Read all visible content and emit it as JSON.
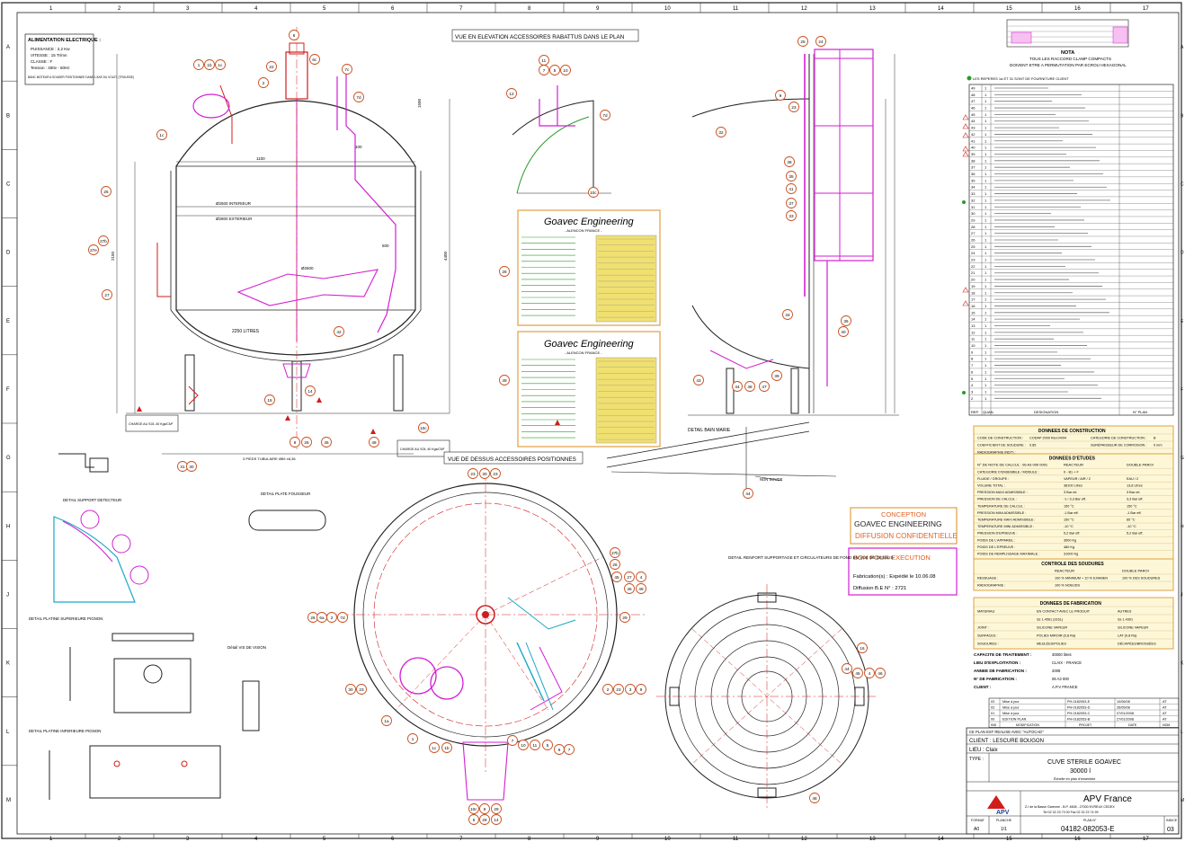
{
  "grid": {
    "columns": [
      "1",
      "2",
      "3",
      "4",
      "5",
      "6",
      "7",
      "8",
      "9",
      "10",
      "11",
      "12",
      "13",
      "14",
      "15",
      "16",
      "17"
    ],
    "rows": [
      "A",
      "B",
      "C",
      "D",
      "E",
      "F",
      "G",
      "H",
      "J",
      "K",
      "L",
      "M"
    ]
  },
  "views": {
    "elevation_title": "VUE EN ELEVATION ACCESSOIRES RABATTUS DANS LE PLAN",
    "top_title": "VUE DE DESSUS ACCESSOIRES POSITIONNES",
    "bain_marie": "DETAIL BAIN MARIE",
    "support_detail": "DETAIL SUPPORT DETECTEUR",
    "plate_detail": "DETAIL PLATE FOUSSEUR",
    "platine_sup": "DETAIL PLATINE SUPERIEURE PIGNON",
    "platine_inf": "DETAIL PLATINE INFERIEURE PIGNON",
    "vis_detail": "Détail VIS DE VISION",
    "support_fond": "DETAIL RENFORT SUPPORTAGE ET CIRCULATEURS DE FOND EN VUE DE DESSUS",
    "non_soude": "NON SOUDE"
  },
  "elevation": {
    "alim_title": "ALIMENTATION ELECTRIQUE :",
    "alim_lines": [
      "PUISSANCE : 2,2 Kw",
      "VITESSE : 15 Tr/mn",
      "CLASSE : F",
      "Tension : 400v - 50Hz"
    ],
    "alim_note": "BANC MOTEUR A SOUDER POSITIONNEE DANS L'AXE DU VOLET (TROUSSE)",
    "litres": "2250 LITRES",
    "charge_left": "CHARGE AU SOL 40 Kgs/CM²",
    "charge_right": "CHARGE AU SOL 40 Kgs/CM²",
    "pieds": "3 PIEDS TUBULAIRE Ø89 ±8,36",
    "dims": [
      "Ø2600",
      "Ø2500 INTERIEUR",
      "Ø2800 EXTERIEUR",
      "1100",
      "4400",
      "500",
      "1500",
      "2150",
      "100"
    ]
  },
  "goavec_plates": [
    {
      "name": "Goavec Engineering",
      "sub": "- ALENCON FRANCE -"
    },
    {
      "name": "Goavec Engineering",
      "sub": "- ALENCON FRANCE -"
    }
  ],
  "conception": {
    "l1": "CONCEPTION",
    "l2": "GOAVEC ENGINEERING",
    "l3": "DIFFUSION CONFIDENTIELLE"
  },
  "bon_pour": {
    "title": "BON POUR EXECUTION",
    "fab": "Fabrication(s) : Expédié le 10.06.08",
    "diff": "Diffusion B.E N° : 2721"
  },
  "nota": {
    "title": "NOTA",
    "lines": [
      "TOUS LES RACCORD CLAMP COMPACTS",
      "DOIVENT ETRE A PERMUTATION PAR ECROU HEXAGONAL"
    ]
  },
  "nomenclature_note": "LES REPERES 1a ET 31 SONT DE FOURNITURE CLIENT",
  "nomenclature_header": [
    "REP.",
    "QUAN.",
    "DESIGNATION",
    "N° PLAN"
  ],
  "construction": {
    "title": "DONNEES DE CONSTRUCTION",
    "rows": [
      [
        "CODE DE CONSTRUCTION :",
        "CODAP 2000 Rev.04/04",
        "CATEGORIE DE CONSTRUCTION :",
        "B"
      ],
      [
        "COEFFICIENT DE SOUDURE :",
        "0.85",
        "SURÉPAISSEUR DE CORROSION :",
        "0 mm"
      ],
      [
        "RADIOGRAPHIE (NDT) :",
        "",
        "",
        ""
      ]
    ]
  },
  "etudes": {
    "title": "DONNEES D'ETUDES",
    "note_calcul": "N° DE NOTE DE CALCUL : 06 A3 000 0001",
    "cols": [
      "",
      "REACTEUR",
      "DOUBLE PAROI"
    ],
    "rows": [
      [
        "CATEGORIE D'ENSEMBLE / MODULE :",
        "II - B1 + F",
        ""
      ],
      [
        "FLUIDE / GROUPE :",
        "VAPEUR / AIR / 2",
        "EAU / 2"
      ],
      [
        "VOLUME TOTAL :",
        "38100 Litres",
        "13,8 Litres"
      ],
      [
        "PRESSION MAXI ADMISSIBLE :",
        "3 Bar rel.",
        "3 Bar rel."
      ],
      [
        "PRESSION DE CALCUL :",
        "-1 / 3,3 Bar eff.",
        "3,3 Bar eff."
      ],
      [
        "TEMPERATURE DE CALCUL :",
        "150 °C",
        "150 °C"
      ],
      [
        "PRESSION MINI ADMISSIBLE :",
        "-1 Bar eff.",
        "-1 Bar eff."
      ],
      [
        "TEMPERATURE MAXI ADMISSIBLE :",
        "150 °C",
        "65 °C"
      ],
      [
        "TEMPERATURE MINI ADMISSIBLE :",
        "-10 °C",
        "-10 °C"
      ],
      [
        "PRESSION D'EPREUVE :",
        "5,2 Bar eff.",
        "5,2 Bar eff."
      ],
      [
        "POIDS DE L'APPAREIL :",
        "3500 Kg",
        ""
      ],
      [
        "POIDS DE L'EPREUVE :",
        "480 Kg",
        ""
      ],
      [
        "POIDS DE REMPLISSAGE MAXIMALE :",
        "31000 Kg",
        ""
      ]
    ]
  },
  "soudures": {
    "title": "CONTROLE DES SOUDURES",
    "cols": [
      "",
      "REACTEUR",
      "DOUBLE PAROI"
    ],
    "rows": [
      [
        "RESSUAGE :",
        "100 % MINIMUM + 10 % EXAMEN",
        "100 % DES SOUDURES"
      ],
      [
        "RADIOGRAPHIE :",
        "100 % NOEUDS",
        ""
      ]
    ]
  },
  "fabrication": {
    "title": "DONNEES DE FABRICATION",
    "rows": [
      [
        "MATERIAU",
        "EN CONTACT AVEC LE PRODUIT",
        "AUTRES"
      ],
      [
        "",
        "Ss 1.4561 (316L)",
        "Ss 1.4301"
      ],
      [
        "JOINT :",
        "SILICONE VAPEUR",
        "SILICONE VAPEUR"
      ],
      [
        "SURFACES :",
        "POLIES MIROIR (0,8 Ra)",
        "LAT (0,8 Ra)"
      ],
      [
        "SOUDURES :",
        "MEULÉES/POLIES",
        "DÉCAPÉES/BROSSÉES"
      ]
    ]
  },
  "capacity": [
    [
      "CAPACITE DE TRAITEMENT :",
      "30000 litres"
    ],
    [
      "LIEU D'EXPLOITATION :",
      "CLAIX - FRANCE"
    ],
    [
      "ANNEE DE FABRICATION :",
      "2008"
    ],
    [
      "N° DE FABRICATION :",
      "06 A3 000"
    ],
    [
      "CLIENT :",
      "A.P.V FRANCE"
    ]
  ],
  "revisions": [
    [
      "03",
      "Mise à jour",
      "PH-0182053-E",
      "10/06/08",
      "AT"
    ],
    [
      "02",
      "Mise à jour",
      "PH-0182053-D",
      "26/05/08",
      "AT"
    ],
    [
      "01",
      "Mise à jour",
      "PH-0182053-C",
      "07/01/2008",
      "AT"
    ],
    [
      "00",
      "EDITION PLAN",
      "PH-0182053-B",
      "27/01/2008",
      "AT"
    ]
  ],
  "revision_header": [
    "IND",
    "MODIFICATION",
    "PROJET",
    "DATE",
    "NOM"
  ],
  "title_block": {
    "plan_note": "CE PLAN EST REALISE AVEC \"AUTOCAD\"",
    "client": "CLIENT : LESCURE BOUGON",
    "lieu": "LIEU : Claix",
    "type_label": "TYPE :",
    "title1": "CUVE STERILE GOAVEC",
    "title2": "30000 l",
    "echelle": "Échelle en plan d'ensemble",
    "company": "APV France",
    "logo": "APV",
    "address": "Z.I de la Basse Garenne - B.P. 4608 - 27000 EVREUX CEDEX",
    "phone": "Tel 02 32 23 73 00  Fax 02 32 23 74 99",
    "format_label": "FORMAT",
    "format": "A0",
    "planche_label": "PLANCHE",
    "planche": "1/1",
    "plan_label": "PLAN N°",
    "plan_no": "04182-082053-E",
    "indice_label": "INDICE",
    "indice": "03"
  },
  "colors": {
    "accent_red": "#d11c1c",
    "magenta": "#d21fd2",
    "cyan": "#1aa6c8",
    "green": "#2a9a2a",
    "yellow": "#f0e070",
    "orange": "#e0a040",
    "ink": "#1a1a1a"
  }
}
